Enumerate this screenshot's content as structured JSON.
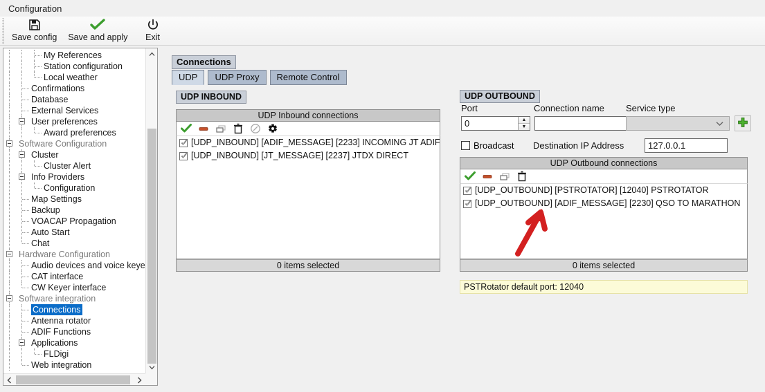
{
  "window": {
    "title": "Configuration"
  },
  "toolbar": {
    "buttons": [
      {
        "label": "Save config",
        "icon": "floppy-disk-icon"
      },
      {
        "label": "Save and apply",
        "icon": "green-check-icon"
      },
      {
        "label": "Exit",
        "icon": "power-icon"
      }
    ]
  },
  "sidebar": {
    "items": [
      {
        "label": "My References",
        "depth": 3,
        "expander": false,
        "greyed": false,
        "selected": false
      },
      {
        "label": "Station configuration",
        "depth": 3,
        "expander": false,
        "greyed": false,
        "selected": false
      },
      {
        "label": "Local weather",
        "depth": 3,
        "expander": false,
        "greyed": false,
        "selected": false,
        "last": true
      },
      {
        "label": "Confirmations",
        "depth": 2,
        "expander": false,
        "greyed": false,
        "selected": false
      },
      {
        "label": "Database",
        "depth": 2,
        "expander": false,
        "greyed": false,
        "selected": false
      },
      {
        "label": "External Services",
        "depth": 2,
        "expander": false,
        "greyed": false,
        "selected": false
      },
      {
        "label": "User preferences",
        "depth": 2,
        "expander": true,
        "greyed": false,
        "selected": false
      },
      {
        "label": "Award preferences",
        "depth": 3,
        "expander": false,
        "greyed": false,
        "selected": false,
        "last": true
      },
      {
        "label": "Software Configuration",
        "depth": 1,
        "expander": true,
        "greyed": true,
        "selected": false
      },
      {
        "label": "Cluster",
        "depth": 2,
        "expander": true,
        "greyed": false,
        "selected": false
      },
      {
        "label": "Cluster Alert",
        "depth": 3,
        "expander": false,
        "greyed": false,
        "selected": false,
        "last": true
      },
      {
        "label": "Info Providers",
        "depth": 2,
        "expander": true,
        "greyed": false,
        "selected": false
      },
      {
        "label": "Configuration",
        "depth": 3,
        "expander": false,
        "greyed": false,
        "selected": false,
        "last": true
      },
      {
        "label": "Map Settings",
        "depth": 2,
        "expander": false,
        "greyed": false,
        "selected": false
      },
      {
        "label": "Backup",
        "depth": 2,
        "expander": false,
        "greyed": false,
        "selected": false
      },
      {
        "label": "VOACAP Propagation",
        "depth": 2,
        "expander": false,
        "greyed": false,
        "selected": false
      },
      {
        "label": "Auto Start",
        "depth": 2,
        "expander": false,
        "greyed": false,
        "selected": false
      },
      {
        "label": "Chat",
        "depth": 2,
        "expander": false,
        "greyed": false,
        "selected": false,
        "last": true
      },
      {
        "label": "Hardware Configuration",
        "depth": 1,
        "expander": true,
        "greyed": true,
        "selected": false
      },
      {
        "label": "Audio devices and voice keye",
        "depth": 2,
        "expander": false,
        "greyed": false,
        "selected": false
      },
      {
        "label": "CAT interface",
        "depth": 2,
        "expander": false,
        "greyed": false,
        "selected": false
      },
      {
        "label": "CW Keyer interface",
        "depth": 2,
        "expander": false,
        "greyed": false,
        "selected": false,
        "last": true
      },
      {
        "label": "Software integration",
        "depth": 1,
        "expander": true,
        "greyed": true,
        "selected": false
      },
      {
        "label": "Connections",
        "depth": 2,
        "expander": false,
        "greyed": false,
        "selected": true
      },
      {
        "label": "Antenna rotator",
        "depth": 2,
        "expander": false,
        "greyed": false,
        "selected": false
      },
      {
        "label": "ADIF Functions",
        "depth": 2,
        "expander": false,
        "greyed": false,
        "selected": false
      },
      {
        "label": "Applications",
        "depth": 2,
        "expander": true,
        "greyed": false,
        "selected": false
      },
      {
        "label": "FLDigi",
        "depth": 3,
        "expander": false,
        "greyed": false,
        "selected": false,
        "last": true
      },
      {
        "label": "Web integration",
        "depth": 2,
        "expander": false,
        "greyed": false,
        "selected": false,
        "last": true
      }
    ],
    "scroll": {
      "up_glyph": "▲",
      "down_glyph": "▼",
      "left_glyph": "‹",
      "right_glyph": "›"
    }
  },
  "main": {
    "page_title": "Connections",
    "tabs": [
      {
        "label": "UDP",
        "active": true
      },
      {
        "label": "UDP Proxy",
        "active": false
      },
      {
        "label": "Remote Control",
        "active": false
      }
    ],
    "inbound": {
      "badge": "UDP INBOUND",
      "list_header": "UDP Inbound connections",
      "toolbar_icons": [
        "enable-check-icon",
        "disable-minus-icon",
        "duplicate-icon",
        "delete-trash-icon",
        "edit-disabled-icon",
        "add-plus-icon"
      ],
      "rows": [
        {
          "checked": true,
          "text": "[UDP_INBOUND] [ADIF_MESSAGE] [2233] INCOMING JT ADIF"
        },
        {
          "checked": true,
          "text": "[UDP_INBOUND] [JT_MESSAGE] [2237] JTDX DIRECT"
        }
      ],
      "status": "0 items selected"
    },
    "outbound": {
      "badge": "UDP OUTBOUND",
      "labels": {
        "port": "Port",
        "connection_name": "Connection name",
        "service_type": "Service type",
        "broadcast": "Broadcast",
        "destination_ip": "Destination IP Address"
      },
      "values": {
        "port": "0",
        "connection_name": "",
        "connection_name_placeholder": "",
        "service_type": "",
        "broadcast_checked": false,
        "destination_ip": "127.0.0.1"
      },
      "add_button_icon": "green-plus-icon",
      "list_header": "UDP Outbound connections",
      "toolbar_icons": [
        "enable-check-icon",
        "disable-minus-icon",
        "duplicate-icon",
        "delete-trash-icon"
      ],
      "rows": [
        {
          "checked": true,
          "text": "[UDP_OUTBOUND] [PSTROTATOR] [12040] PSTROTATOR"
        },
        {
          "checked": true,
          "text": "[UDP_OUTBOUND] [ADIF_MESSAGE] [2230] QSO TO MARATHON"
        }
      ],
      "status": "0 items selected",
      "hint": "PSTRotator default port: 12040"
    }
  },
  "annotation": {
    "type": "red-arrow",
    "color": "#d32020"
  },
  "colors": {
    "selection_blue": "#0a6cc8",
    "badge_bg": "#c9cfd8",
    "tab_bg": "#aebbcd",
    "tab_active_bg": "#cfd9e6",
    "hint_bg": "#fcfbd8",
    "green": "#3aa33a",
    "red": "#cc4422"
  }
}
